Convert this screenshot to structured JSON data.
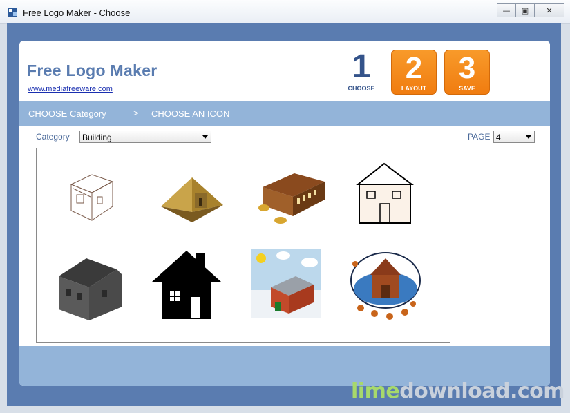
{
  "window": {
    "title": "Free Logo Maker - Choose",
    "buttons": {
      "minimize": "—",
      "maximize": "▣",
      "close": "✕"
    }
  },
  "brand": {
    "title": "Free Logo Maker",
    "link": "www.mediafreeware.com"
  },
  "steps": [
    {
      "number": "1",
      "label": "CHOOSE"
    },
    {
      "number": "2",
      "label": "LAYOUT"
    },
    {
      "number": "3",
      "label": "SAVE"
    }
  ],
  "breadcrumb": {
    "current": "CHOOSE Category",
    "separator": ">",
    "next": "CHOOSE AN ICON"
  },
  "controls": {
    "category_label": "Category",
    "category_value": "Building",
    "page_label": "PAGE",
    "page_value": "4"
  },
  "icons": [
    {
      "name": "sketch-house-icon"
    },
    {
      "name": "pyramid-icon"
    },
    {
      "name": "barn-icon"
    },
    {
      "name": "simple-outline-house-icon"
    },
    {
      "name": "gray-house-icon"
    },
    {
      "name": "black-house-silhouette-icon"
    },
    {
      "name": "snowy-house-scene-icon"
    },
    {
      "name": "autumn-schoolhouse-icon"
    }
  ],
  "watermark": {
    "part1": "lime",
    "part2": "download.com"
  },
  "colors": {
    "frame": "#5a7cb0",
    "band": "#93b4d9",
    "accent_orange": "#f28a1e"
  }
}
